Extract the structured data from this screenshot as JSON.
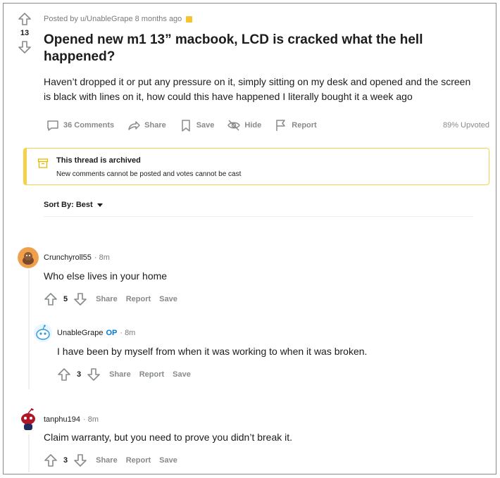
{
  "post": {
    "score": "13",
    "meta_posted": "Posted by u/UnableGrape 8 months ago",
    "title": "Opened new m1 13” macbook, LCD is cracked what the hell happened?",
    "body": "Haven’t dropped it or put any pressure on it, simply sitting on my desk and opened and the screen is black with lines on it, how could this have happened I literally bought it a week ago",
    "actions": {
      "comments": "36 Comments",
      "share": "Share",
      "save": "Save",
      "hide": "Hide",
      "report": "Report"
    },
    "upvoted": "89% Upvoted"
  },
  "archived": {
    "title": "This thread is archived",
    "subtitle": "New comments cannot be posted and votes cannot be cast"
  },
  "sort": {
    "label": "Sort By: Best"
  },
  "comments": [
    {
      "author": "Crunchyroll55",
      "time": "· 8m",
      "text": "Who else lives in your home",
      "score": "5",
      "share": "Share",
      "report": "Report",
      "save": "Save"
    },
    {
      "author": "UnableGrape",
      "op": "OP",
      "time": "· 8m",
      "text": "I have been by myself from when it was working to when it was broken.",
      "score": "3",
      "share": "Share",
      "report": "Report",
      "save": "Save"
    },
    {
      "author": "tanphu194",
      "time": "· 8m",
      "text": "Claim warranty, but you need to prove you didn’t break it.",
      "score": "3",
      "share": "Share",
      "report": "Report",
      "save": "Save"
    }
  ],
  "colors": {
    "op": "#0079d3",
    "archived_border": "#f5d24a",
    "muted": "#878a8c"
  }
}
